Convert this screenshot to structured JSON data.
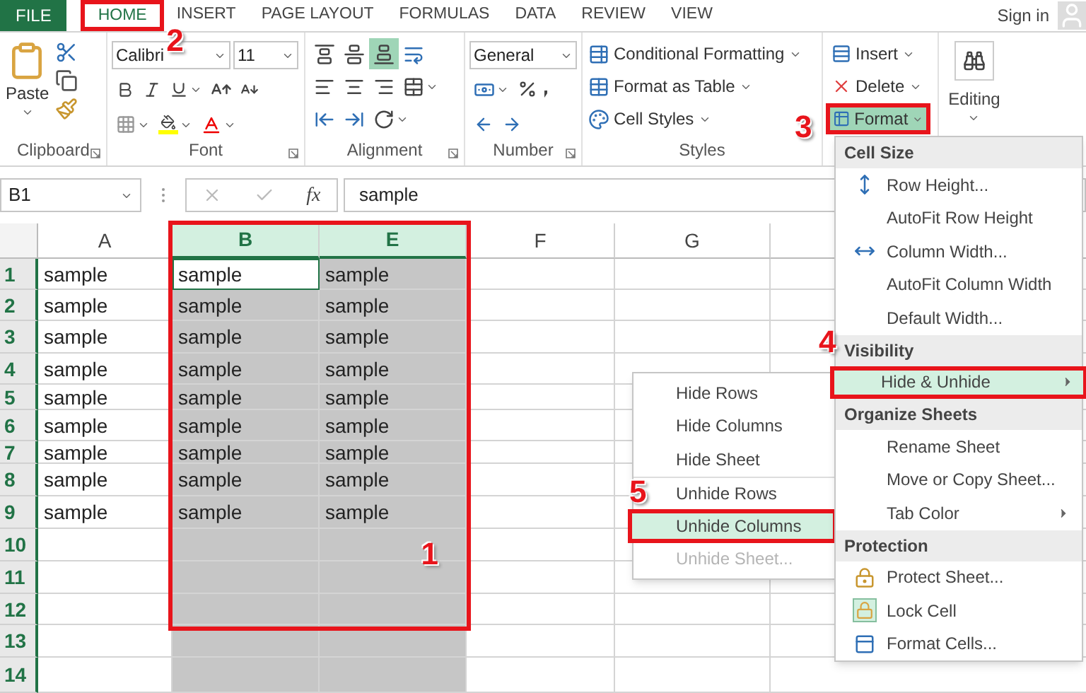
{
  "tabs": [
    {
      "label": "FILE",
      "kind": "file",
      "selected": false
    },
    {
      "label": "HOME",
      "kind": "tab",
      "selected": true,
      "callout": "2"
    },
    {
      "label": "INSERT",
      "kind": "tab",
      "selected": false
    },
    {
      "label": "PAGE LAYOUT",
      "kind": "tab",
      "selected": false
    },
    {
      "label": "FORMULAS",
      "kind": "tab",
      "selected": false
    },
    {
      "label": "DATA",
      "kind": "tab",
      "selected": false
    },
    {
      "label": "REVIEW",
      "kind": "tab",
      "selected": false
    },
    {
      "label": "VIEW",
      "kind": "tab",
      "selected": false
    }
  ],
  "account": {
    "label": "Sign in"
  },
  "ribbon": {
    "clipboard": {
      "label": "Clipboard",
      "paste": "Paste"
    },
    "font": {
      "label": "Font",
      "name": "Calibri",
      "size": "11"
    },
    "alignment": {
      "label": "Alignment",
      "vertical": [
        {
          "kind": "top",
          "selected": false
        },
        {
          "kind": "middle",
          "selected": false
        },
        {
          "kind": "bottom",
          "selected": true
        }
      ]
    },
    "number": {
      "label": "Number",
      "format": "General"
    },
    "styles": {
      "label": "Styles",
      "items": [
        {
          "label": "Conditional Formatting",
          "kind": "conditional"
        },
        {
          "label": "Format as Table",
          "kind": "table"
        },
        {
          "label": "Cell Styles",
          "kind": "styles"
        }
      ]
    },
    "cells": {
      "items": [
        {
          "label": "Insert",
          "kind": "insert",
          "selected": false
        },
        {
          "label": "Delete",
          "kind": "delete",
          "selected": false
        },
        {
          "label": "Format",
          "kind": "format",
          "selected": true,
          "callout": "3"
        }
      ]
    },
    "editing": {
      "label": "Editing"
    }
  },
  "formula_bar": {
    "name_box": "B1",
    "function_label": "fx",
    "value": "sample"
  },
  "grid": {
    "selection_callout": "1",
    "columns": [
      {
        "label": "A",
        "selected": false
      },
      {
        "label": "B",
        "selected": true
      },
      {
        "label": "E",
        "selected": true
      },
      {
        "label": "F",
        "selected": false
      },
      {
        "label": "G",
        "selected": false
      }
    ],
    "rows": [
      {
        "label": "1",
        "cells": [
          {
            "value": "sample",
            "active": false
          },
          {
            "value": "sample",
            "active": true
          },
          {
            "value": "sample",
            "active": false
          }
        ]
      },
      {
        "label": "2",
        "cells": [
          {
            "value": "sample",
            "active": false
          },
          {
            "value": "sample",
            "active": false
          },
          {
            "value": "sample",
            "active": false
          }
        ]
      },
      {
        "label": "3",
        "cells": [
          {
            "value": "sample",
            "active": false
          },
          {
            "value": "sample",
            "active": false
          },
          {
            "value": "sample",
            "active": false
          }
        ]
      },
      {
        "label": "4",
        "cells": [
          {
            "value": "sample",
            "active": false
          },
          {
            "value": "sample",
            "active": false
          },
          {
            "value": "sample",
            "active": false
          }
        ]
      },
      {
        "label": "5",
        "cells": [
          {
            "value": "sample",
            "active": false
          },
          {
            "value": "sample",
            "active": false
          },
          {
            "value": "sample",
            "active": false
          }
        ]
      },
      {
        "label": "6",
        "cells": [
          {
            "value": "sample",
            "active": false
          },
          {
            "value": "sample",
            "active": false
          },
          {
            "value": "sample",
            "active": false
          }
        ]
      },
      {
        "label": "7",
        "cells": [
          {
            "value": "sample",
            "active": false
          },
          {
            "value": "sample",
            "active": false
          },
          {
            "value": "sample",
            "active": false
          }
        ]
      },
      {
        "label": "8",
        "cells": [
          {
            "value": "sample",
            "active": false
          },
          {
            "value": "sample",
            "active": false
          },
          {
            "value": "sample",
            "active": false
          }
        ]
      },
      {
        "label": "9",
        "cells": [
          {
            "value": "sample",
            "active": false
          },
          {
            "value": "sample",
            "active": false
          },
          {
            "value": "sample",
            "active": false
          }
        ]
      },
      {
        "label": "10"
      },
      {
        "label": "11"
      },
      {
        "label": "12"
      },
      {
        "label": "13"
      },
      {
        "label": "14"
      }
    ]
  },
  "format_menu": {
    "sections": [
      {
        "header": "Cell Size",
        "items": [
          {
            "label": "Row Height...",
            "kind": "row-height",
            "selected": false,
            "submenu": false
          },
          {
            "label": "AutoFit Row Height",
            "kind": "plain",
            "selected": false,
            "submenu": false
          },
          {
            "label": "Column Width...",
            "kind": "column-width",
            "selected": false,
            "submenu": false
          },
          {
            "label": "AutoFit Column Width",
            "kind": "plain",
            "selected": false,
            "submenu": false
          },
          {
            "label": "Default Width...",
            "kind": "plain",
            "selected": false,
            "submenu": false
          }
        ]
      },
      {
        "header": "Visibility",
        "callout": "4",
        "items": [
          {
            "label": "Hide & Unhide",
            "kind": "plain",
            "selected": true,
            "submenu": true
          }
        ]
      },
      {
        "header": "Organize Sheets",
        "items": [
          {
            "label": "Rename Sheet",
            "kind": "plain",
            "selected": false,
            "submenu": false
          },
          {
            "label": "Move or Copy Sheet...",
            "kind": "plain",
            "selected": false,
            "submenu": false
          },
          {
            "label": "Tab Color",
            "kind": "plain",
            "selected": false,
            "submenu": true
          }
        ]
      },
      {
        "header": "Protection",
        "items": [
          {
            "label": "Protect Sheet...",
            "kind": "protect",
            "selected": false,
            "submenu": false
          },
          {
            "label": "Lock Cell",
            "kind": "lock",
            "selected": false,
            "submenu": false
          },
          {
            "label": "Format Cells...",
            "kind": "format-cells",
            "selected": false,
            "submenu": false
          }
        ]
      }
    ]
  },
  "submenu": {
    "items": [
      {
        "label": "Hide Rows",
        "selected": false,
        "disabled": false,
        "separator": false
      },
      {
        "label": "Hide Columns",
        "selected": false,
        "disabled": false,
        "separator": false
      },
      {
        "label": "Hide Sheet",
        "selected": false,
        "disabled": false,
        "separator": false
      },
      {
        "label": "Unhide Rows",
        "selected": false,
        "disabled": false,
        "separator": true
      },
      {
        "label": "Unhide Columns",
        "selected": true,
        "disabled": false,
        "separator": false,
        "callout": "5"
      },
      {
        "label": "Unhide Sheet...",
        "selected": false,
        "disabled": true,
        "separator": false
      }
    ]
  }
}
